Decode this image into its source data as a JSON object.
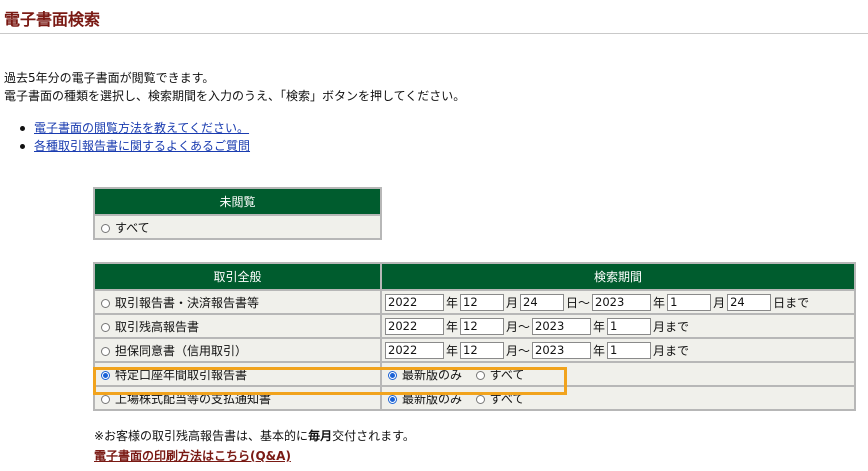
{
  "page": {
    "title": "電子書面検索",
    "intro_line1": "過去5年分の電子書面が閲覧できます。",
    "intro_line2": "電子書面の種類を選択し、検索期間を入力のうえ、「検索」ボタンを押してください。"
  },
  "links": [
    {
      "label": "電子書面の閲覧方法を教えてください。"
    },
    {
      "label": "各種取引報告書に関するよくあるご質問"
    }
  ],
  "unread_table": {
    "header": "未閲覧",
    "option_all": "すべて"
  },
  "main_table": {
    "col1_header": "取引全般",
    "col2_header": "検索期間",
    "rows": [
      {
        "label": "取引報告書・決済報告書等",
        "selected": false,
        "from_year": "2022",
        "from_month": "12",
        "from_day": "24",
        "to_year": "2023",
        "to_month": "1",
        "to_day": "24"
      },
      {
        "label": "取引残高報告書",
        "selected": false,
        "from_year": "2022",
        "from_month": "12",
        "to_year": "2023",
        "to_month": "1"
      },
      {
        "label": "担保同意書（信用取引）",
        "selected": false,
        "from_year": "2022",
        "from_month": "12",
        "to_year": "2023",
        "to_month": "1"
      },
      {
        "label": "特定口座年間取引報告書",
        "selected": true,
        "opt_latest": "最新版のみ",
        "opt_all": "すべて",
        "latest_selected": true
      },
      {
        "label": "上場株式配当等の支払通知書",
        "selected": false,
        "opt_latest": "最新版のみ",
        "opt_all": "すべて",
        "latest_selected": true
      }
    ]
  },
  "units": {
    "year": "年",
    "month": "月",
    "day_range": "日～",
    "day_until": "日まで",
    "month_range": "月～",
    "month_until": "月まで"
  },
  "note": {
    "prefix": "※お客様の取引残高報告書は、基本的に",
    "bold": "毎月",
    "suffix": "交付されます。"
  },
  "print_link": "電子書面の印刷方法はこちら(Q&A)",
  "colors": {
    "title": "#7a1a14",
    "header_bg": "#005c2e",
    "highlight": "#f1a31d",
    "link": "#1a3cb0"
  }
}
